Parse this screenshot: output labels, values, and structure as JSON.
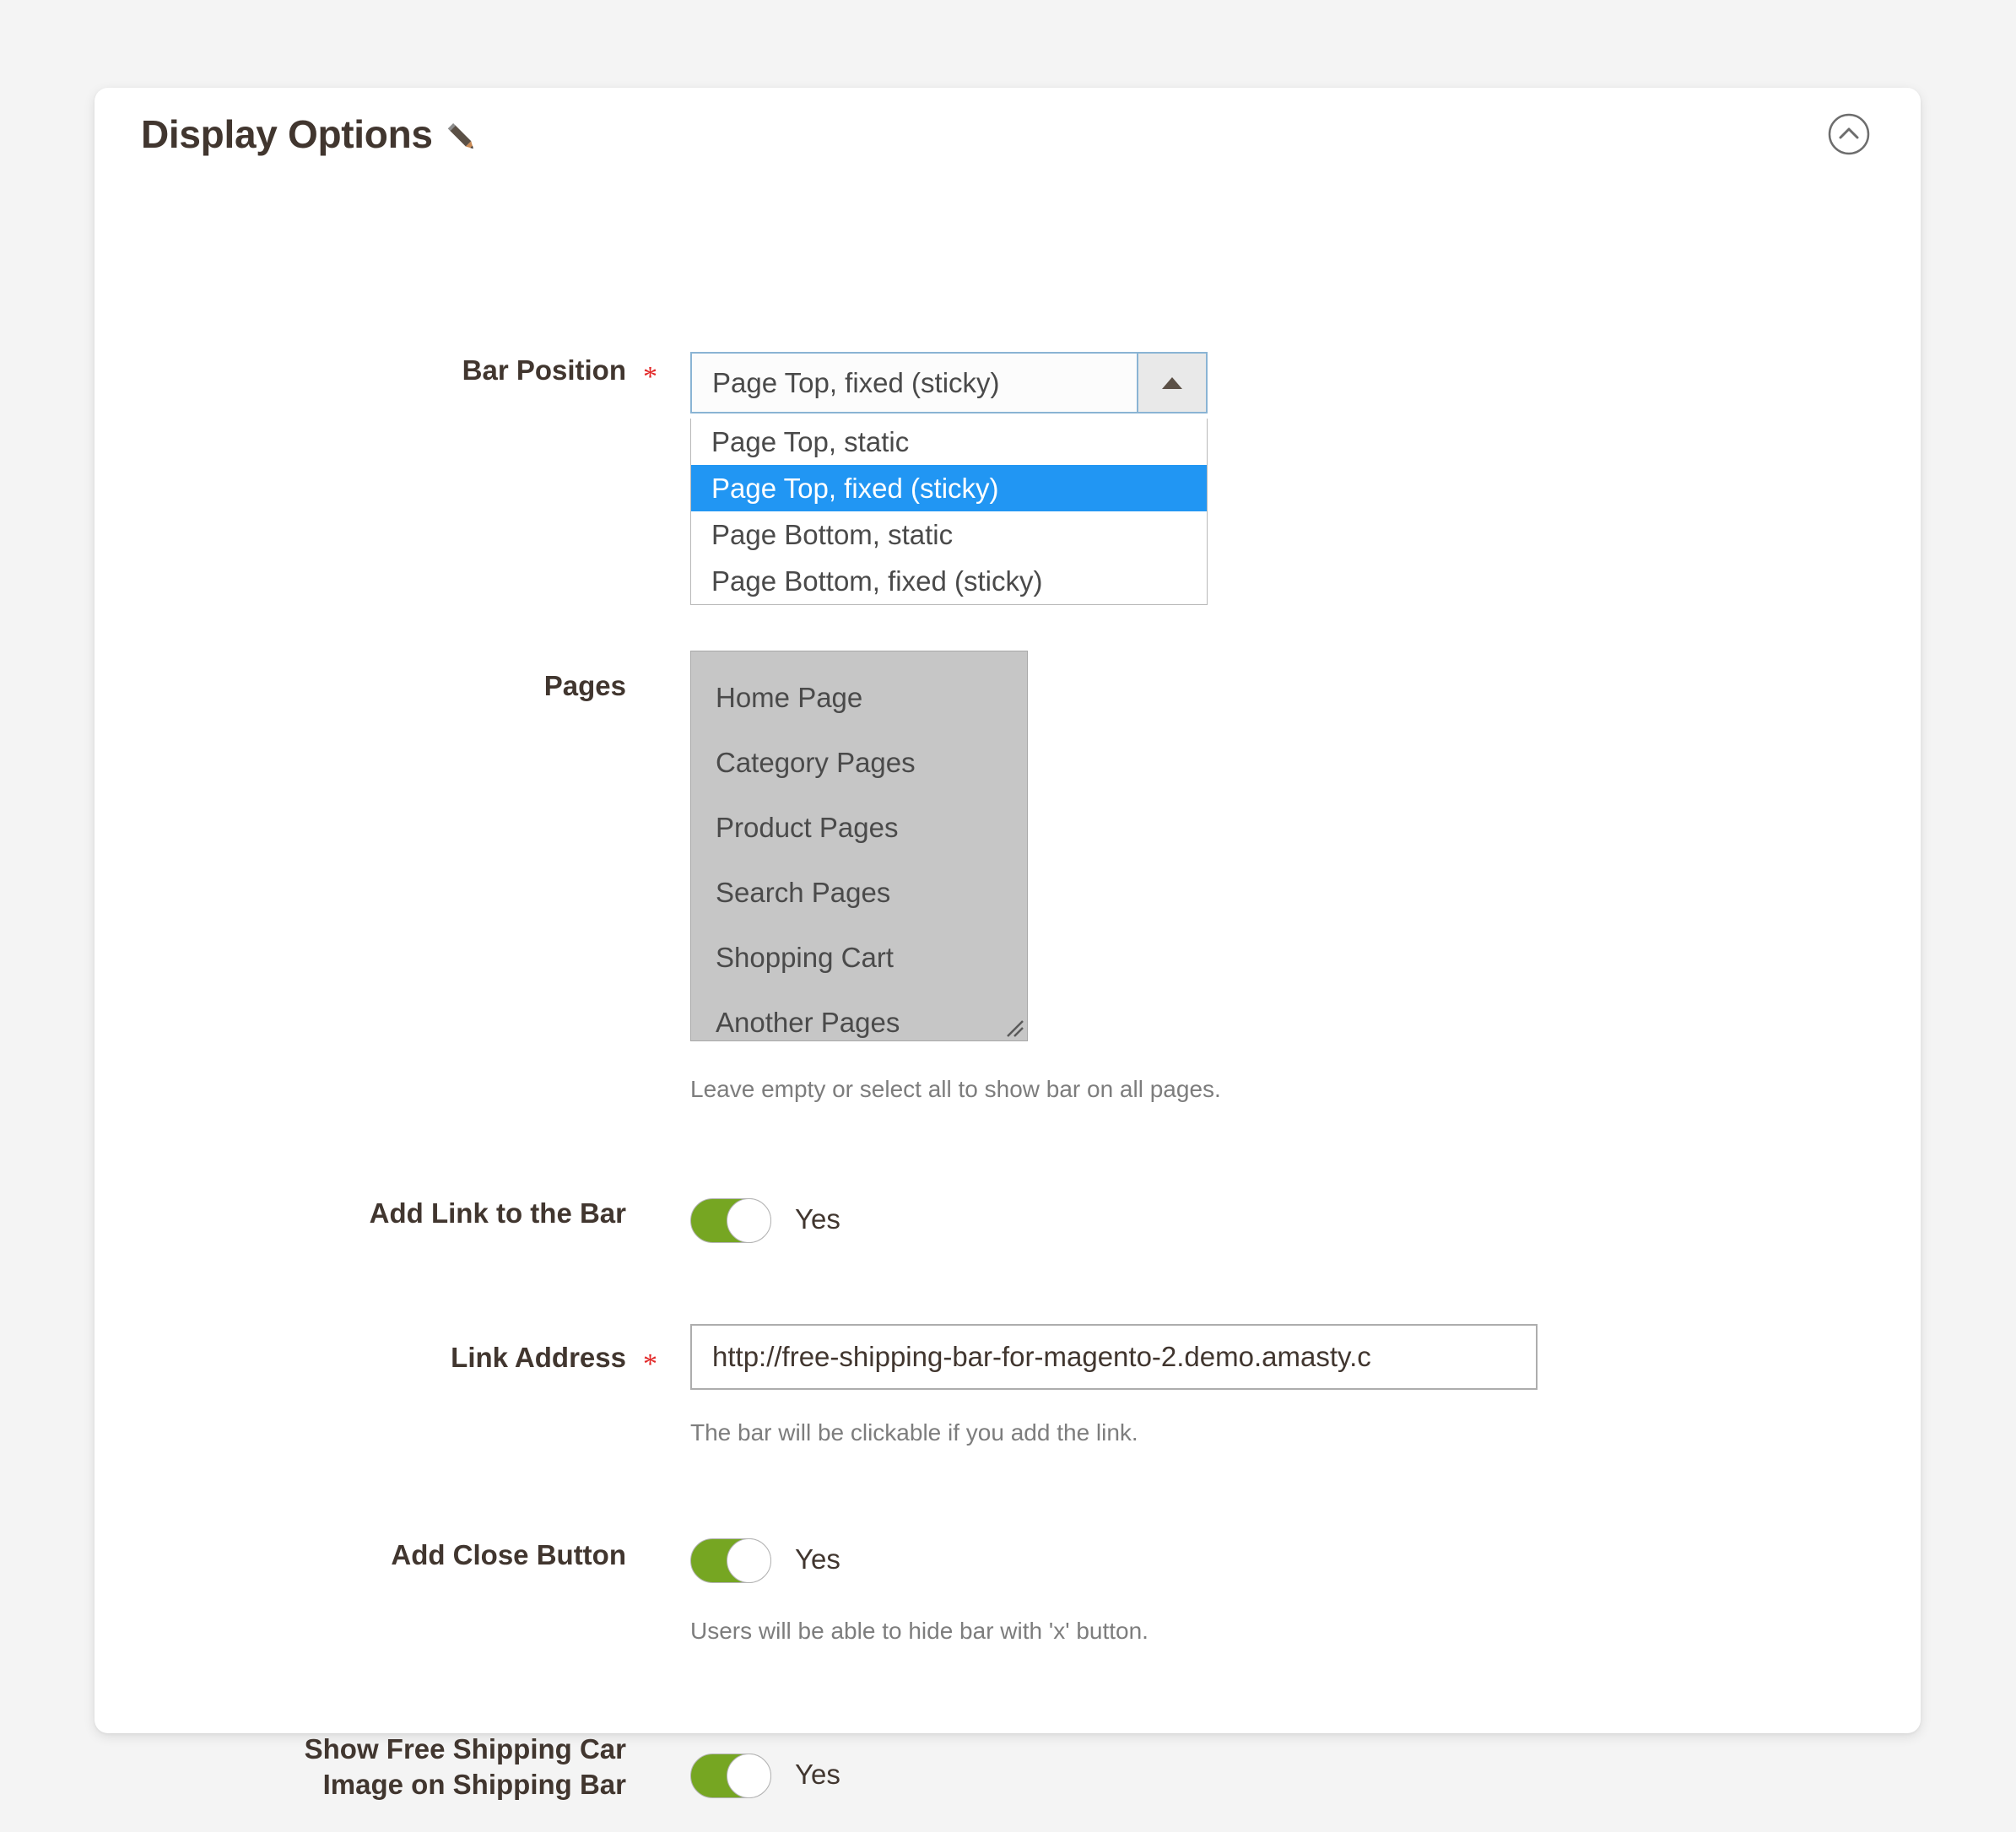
{
  "panel": {
    "title": "Display Options",
    "edit_icon": "pencil-icon",
    "collapse_icon": "chevron-up-circle-icon"
  },
  "fields": {
    "bar_position": {
      "label": "Bar Position",
      "required_marker": "*",
      "selected_value": "Page Top, fixed (sticky)",
      "expanded": true,
      "options": [
        "Page Top, static",
        "Page Top, fixed (sticky)",
        "Page Bottom, static",
        "Page Bottom, fixed (sticky)"
      ],
      "selected_index": 1
    },
    "pages": {
      "label": "Pages",
      "options": [
        "Home Page",
        "Category Pages",
        "Product Pages",
        "Search Pages",
        "Shopping Cart",
        "Another Pages"
      ],
      "note": "Leave empty or select all to show bar on all pages."
    },
    "add_link": {
      "label": "Add Link to the Bar",
      "toggle_value": "Yes"
    },
    "link_address": {
      "label": "Link Address",
      "required_marker": "*",
      "value": "http://free-shipping-bar-for-magento-2.demo.amasty.c",
      "note": "The bar will be clickable if you add the link."
    },
    "add_close_button": {
      "label": "Add Close Button",
      "toggle_value": "Yes",
      "note": "Users will be able to hide bar with 'x' button."
    },
    "show_car_image": {
      "label_line1": "Show Free Shipping Car",
      "label_line2": "Image on Shipping Bar",
      "toggle_value": "Yes"
    }
  },
  "colors": {
    "page_background": "#f4f4f4",
    "panel_background": "#ffffff",
    "toggle_on": "#76a622",
    "option_highlight": "#2196f3",
    "required_star": "#e22626",
    "label_text": "#41362f",
    "note_text": "#7d7d7d",
    "multiselect_background": "#c6c6c6",
    "select_border_focus": "#8ab4d4"
  }
}
